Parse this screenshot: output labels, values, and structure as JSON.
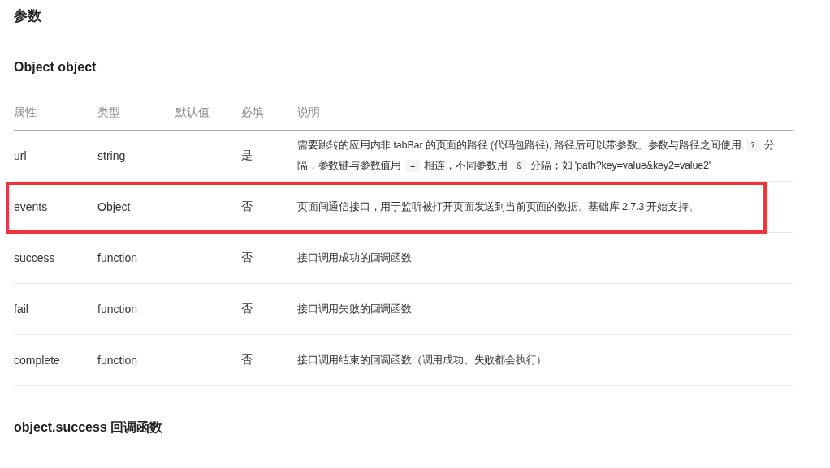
{
  "title": "参数",
  "section": {
    "title": "Object object",
    "table": {
      "columns": [
        "属性",
        "类型",
        "默认值",
        "必填",
        "说明"
      ],
      "rows": [
        {
          "name": "url",
          "type": "string",
          "default": "",
          "required": "是",
          "highlighted": false,
          "description": [
            {
              "kind": "text",
              "text": "需要跳转的应用内非 tabBar 的页面的路径 (代码包路径), 路径后可以带参数。参数与路径之间使用 "
            },
            {
              "kind": "code",
              "text": "?"
            },
            {
              "kind": "text",
              "text": " 分隔，参数键与参数值用 "
            },
            {
              "kind": "code",
              "text": "="
            },
            {
              "kind": "text",
              "text": " 相连，不同参数用 "
            },
            {
              "kind": "code",
              "text": "&"
            },
            {
              "kind": "text",
              "text": " 分隔；如 'path?key=value&key2=value2'"
            }
          ]
        },
        {
          "name": "events",
          "type": "Object",
          "required": "否",
          "highlighted": true,
          "description": [
            {
              "kind": "text",
              "text": "页面间通信接口，用于监听被打开页面发送到当前页面的数据。基础库 2.7.3 开始支持。"
            }
          ]
        },
        {
          "name": "success",
          "type": "function",
          "required": "否",
          "highlighted": false,
          "description": [
            {
              "kind": "text",
              "text": "接口调用成功的回调函数"
            }
          ]
        },
        {
          "name": "fail",
          "type": "function",
          "required": "否",
          "highlighted": false,
          "description": [
            {
              "kind": "text",
              "text": "接口调用失败的回调函数"
            }
          ]
        },
        {
          "name": "complete",
          "type": "function",
          "required": "否",
          "highlighted": false,
          "description": [
            {
              "kind": "text",
              "text": "接口调用结束的回调函数（调用成功、失败都会执行）"
            }
          ]
        }
      ]
    }
  },
  "next_section": {
    "title": "object.success 回调函数"
  }
}
